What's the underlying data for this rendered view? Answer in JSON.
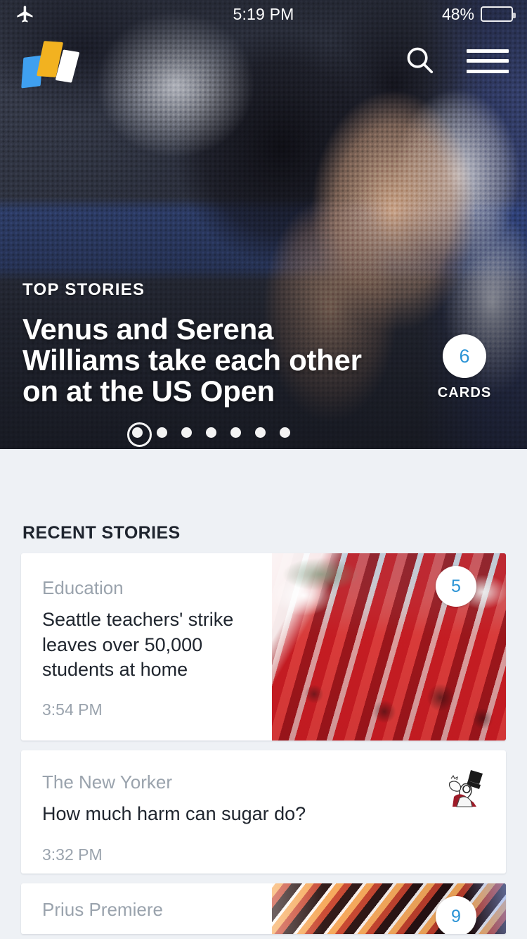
{
  "status_bar": {
    "airplane_icon": "airplane-mode-icon",
    "time": "5:19 PM",
    "battery_percent": "48%",
    "battery_level": 48
  },
  "header": {
    "logo_name": "yahoo-news-digest-logo",
    "search_icon": "search-icon",
    "menu_icon": "hamburger-menu-icon"
  },
  "hero": {
    "kicker": "TOP STORIES",
    "headline": "Venus and Serena Williams take each other on at the US Open",
    "cards_count": "6",
    "cards_label": "CARDS",
    "pager": {
      "total": 7,
      "active_index": 0
    },
    "image_alt": "venus-and-serena-williams-embrace-halftone-photo"
  },
  "recent": {
    "section_title": "RECENT STORIES",
    "stories": [
      {
        "category": "Education",
        "title": "Seattle teachers' strike leaves over 50,000 students at home",
        "time": "3:54 PM",
        "badge": "5",
        "thumb": "seattle-teachers-strike-protest-photo"
      },
      {
        "category": "The New Yorker",
        "title": "How much harm can sugar do?",
        "time": "3:32 PM",
        "badge": "",
        "thumb": "new-yorker-eustace-tilley-logo"
      },
      {
        "category": "Prius Premiere",
        "title": "",
        "time": "",
        "badge": "9",
        "thumb": "prius-light-streaks-photo"
      }
    ]
  },
  "colors": {
    "accent_blue": "#2a93d5",
    "page_background": "#eef1f5",
    "card_background": "#ffffff",
    "text_primary": "#1f252e",
    "text_muted": "#9aa3ad",
    "logo_blue": "#3fa0f0",
    "logo_yellow": "#f2b220",
    "logo_white": "#ffffff"
  }
}
